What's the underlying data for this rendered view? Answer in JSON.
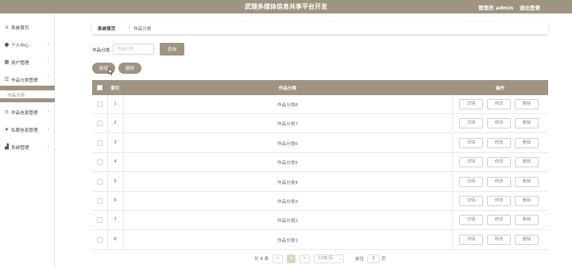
{
  "header": {
    "title": "武理多媒体信息共享平台开发",
    "user_label": "管理员 admin",
    "logout_label": "退出登录"
  },
  "sidebar": {
    "items": [
      {
        "label": "系统首页",
        "icon": "home-icon"
      },
      {
        "label": "个人中心",
        "icon": "user-icon"
      },
      {
        "label": "用户管理",
        "icon": "grid-icon"
      },
      {
        "label": "作品分类管理",
        "icon": "list-icon"
      },
      {
        "label": "作品信息管理",
        "icon": "sliders-icon"
      },
      {
        "label": "私聊信息管理",
        "icon": "send-icon"
      },
      {
        "label": "系统管理",
        "icon": "building-icon"
      }
    ],
    "sub_item": "作品分类"
  },
  "breadcrumb": {
    "home": "系统首页",
    "sep": "/",
    "current": "作品分类"
  },
  "search": {
    "label": "作品分类",
    "placeholder": "作品分类",
    "query_button": "查询"
  },
  "actions": {
    "add": "新增",
    "delete": "删除"
  },
  "table": {
    "headers": {
      "index": "索引",
      "name": "作品分类",
      "ops": "操作"
    },
    "row_buttons": {
      "detail": "详情",
      "edit": "修改",
      "delete": "删除"
    },
    "rows": [
      {
        "index": "1",
        "name": "作品分类8"
      },
      {
        "index": "2",
        "name": "作品分类7"
      },
      {
        "index": "3",
        "name": "作品分类6"
      },
      {
        "index": "4",
        "name": "作品分类5"
      },
      {
        "index": "5",
        "name": "作品分类4"
      },
      {
        "index": "6",
        "name": "作品分类3"
      },
      {
        "index": "7",
        "name": "作品分类2"
      },
      {
        "index": "8",
        "name": "作品分类1"
      }
    ]
  },
  "pagination": {
    "total": "共 8 条",
    "prev": "<",
    "page": "1",
    "next": ">",
    "page_size": "10条/页",
    "goto_label": "前往",
    "goto_value": "1",
    "goto_suffix": "页"
  },
  "colors": {
    "accent": "#9e9480"
  }
}
